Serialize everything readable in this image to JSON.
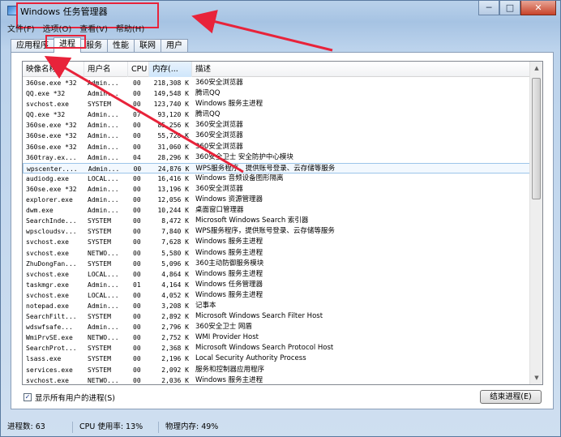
{
  "window": {
    "title": "Windows 任务管理器"
  },
  "window_buttons": {
    "minimize": "─",
    "maximize": "□",
    "close": "✕"
  },
  "menu": [
    "文件(F)",
    "选项(O)",
    "查看(V)",
    "帮助(H)"
  ],
  "tabs": [
    "应用程序",
    "进程",
    "服务",
    "性能",
    "联网",
    "用户"
  ],
  "active_tab": "进程",
  "columns": {
    "name": "映像名称",
    "user": "用户名",
    "cpu": "CPU",
    "mem": "内存(...",
    "desc": "描述"
  },
  "processes": [
    {
      "name": "360se.exe *32",
      "user": "Admin...",
      "cpu": "00",
      "mem": "218,308 K",
      "desc": "360安全浏览器"
    },
    {
      "name": "QQ.exe *32",
      "user": "Admin...",
      "cpu": "00",
      "mem": "149,548 K",
      "desc": "腾讯QQ"
    },
    {
      "name": "svchost.exe",
      "user": "SYSTEM",
      "cpu": "00",
      "mem": "123,740 K",
      "desc": "Windows 服务主进程"
    },
    {
      "name": "QQ.exe *32",
      "user": "Admin...",
      "cpu": "07",
      "mem": "93,120 K",
      "desc": "腾讯QQ"
    },
    {
      "name": "360se.exe *32",
      "user": "Admin...",
      "cpu": "00",
      "mem": "85,256 K",
      "desc": "360安全浏览器"
    },
    {
      "name": "360se.exe *32",
      "user": "Admin...",
      "cpu": "00",
      "mem": "55,720 K",
      "desc": "360安全浏览器"
    },
    {
      "name": "360se.exe *32",
      "user": "Admin...",
      "cpu": "00",
      "mem": "31,060 K",
      "desc": "360安全浏览器"
    },
    {
      "name": "360tray.ex...",
      "user": "Admin...",
      "cpu": "04",
      "mem": "28,296 K",
      "desc": "360安全卫士 安全防护中心模块"
    },
    {
      "name": "wpscenter....",
      "user": "Admin...",
      "cpu": "00",
      "mem": "24,876 K",
      "desc": "WPS服务程序，提供账号登录、云存储等服务"
    },
    {
      "name": "audiodg.exe",
      "user": "LOCAL...",
      "cpu": "00",
      "mem": "16,416 K",
      "desc": "Windows 音频设备图形隔离"
    },
    {
      "name": "360se.exe *32",
      "user": "Admin...",
      "cpu": "00",
      "mem": "13,196 K",
      "desc": "360安全浏览器"
    },
    {
      "name": "explorer.exe",
      "user": "Admin...",
      "cpu": "00",
      "mem": "12,056 K",
      "desc": "Windows 资源管理器"
    },
    {
      "name": "dwm.exe",
      "user": "Admin...",
      "cpu": "00",
      "mem": "10,244 K",
      "desc": "桌面窗口管理器"
    },
    {
      "name": "SearchInde...",
      "user": "SYSTEM",
      "cpu": "00",
      "mem": "8,472 K",
      "desc": "Microsoft Windows Search 索引器"
    },
    {
      "name": "wpscloudsv...",
      "user": "SYSTEM",
      "cpu": "00",
      "mem": "7,840 K",
      "desc": "WPS服务程序，提供账号登录、云存储等服务"
    },
    {
      "name": "svchost.exe",
      "user": "SYSTEM",
      "cpu": "00",
      "mem": "7,628 K",
      "desc": "Windows 服务主进程"
    },
    {
      "name": "svchost.exe",
      "user": "NETWO...",
      "cpu": "00",
      "mem": "5,580 K",
      "desc": "Windows 服务主进程"
    },
    {
      "name": "ZhuDongFan...",
      "user": "SYSTEM",
      "cpu": "00",
      "mem": "5,096 K",
      "desc": "360主动防御服务模块"
    },
    {
      "name": "svchost.exe",
      "user": "LOCAL...",
      "cpu": "00",
      "mem": "4,864 K",
      "desc": "Windows 服务主进程"
    },
    {
      "name": "taskmgr.exe",
      "user": "Admin...",
      "cpu": "01",
      "mem": "4,164 K",
      "desc": "Windows 任务管理器"
    },
    {
      "name": "svchost.exe",
      "user": "LOCAL...",
      "cpu": "00",
      "mem": "4,052 K",
      "desc": "Windows 服务主进程"
    },
    {
      "name": "notepad.exe",
      "user": "Admin...",
      "cpu": "00",
      "mem": "3,208 K",
      "desc": "记事本"
    },
    {
      "name": "SearchFilt...",
      "user": "SYSTEM",
      "cpu": "00",
      "mem": "2,892 K",
      "desc": "Microsoft Windows Search Filter Host"
    },
    {
      "name": "wdswfsafe...",
      "user": "Admin...",
      "cpu": "00",
      "mem": "2,796 K",
      "desc": "360安全卫士 网盾"
    },
    {
      "name": "WmiPrvSE.exe",
      "user": "NETWO...",
      "cpu": "00",
      "mem": "2,752 K",
      "desc": "WMI Provider Host"
    },
    {
      "name": "SearchProt...",
      "user": "SYSTEM",
      "cpu": "00",
      "mem": "2,368 K",
      "desc": "Microsoft Windows Search Protocol Host"
    },
    {
      "name": "lsass.exe",
      "user": "SYSTEM",
      "cpu": "00",
      "mem": "2,196 K",
      "desc": "Local Security Authority Process"
    },
    {
      "name": "services.exe",
      "user": "SYSTEM",
      "cpu": "00",
      "mem": "2,092 K",
      "desc": "服务和控制器应用程序"
    },
    {
      "name": "svchost.exe",
      "user": "NETWO...",
      "cpu": "00",
      "mem": "2,036 K",
      "desc": "Windows 服务主进程"
    }
  ],
  "selected_row": 8,
  "show_all_label": "显示所有用户的进程(S)",
  "show_all_checked": "✓",
  "end_process_label": "结束进程(E)",
  "status": {
    "processes": "进程数: 63",
    "cpu": "CPU 使用率: 13%",
    "memory": "物理内存: 49%"
  },
  "annotation_color": "#e8233a"
}
